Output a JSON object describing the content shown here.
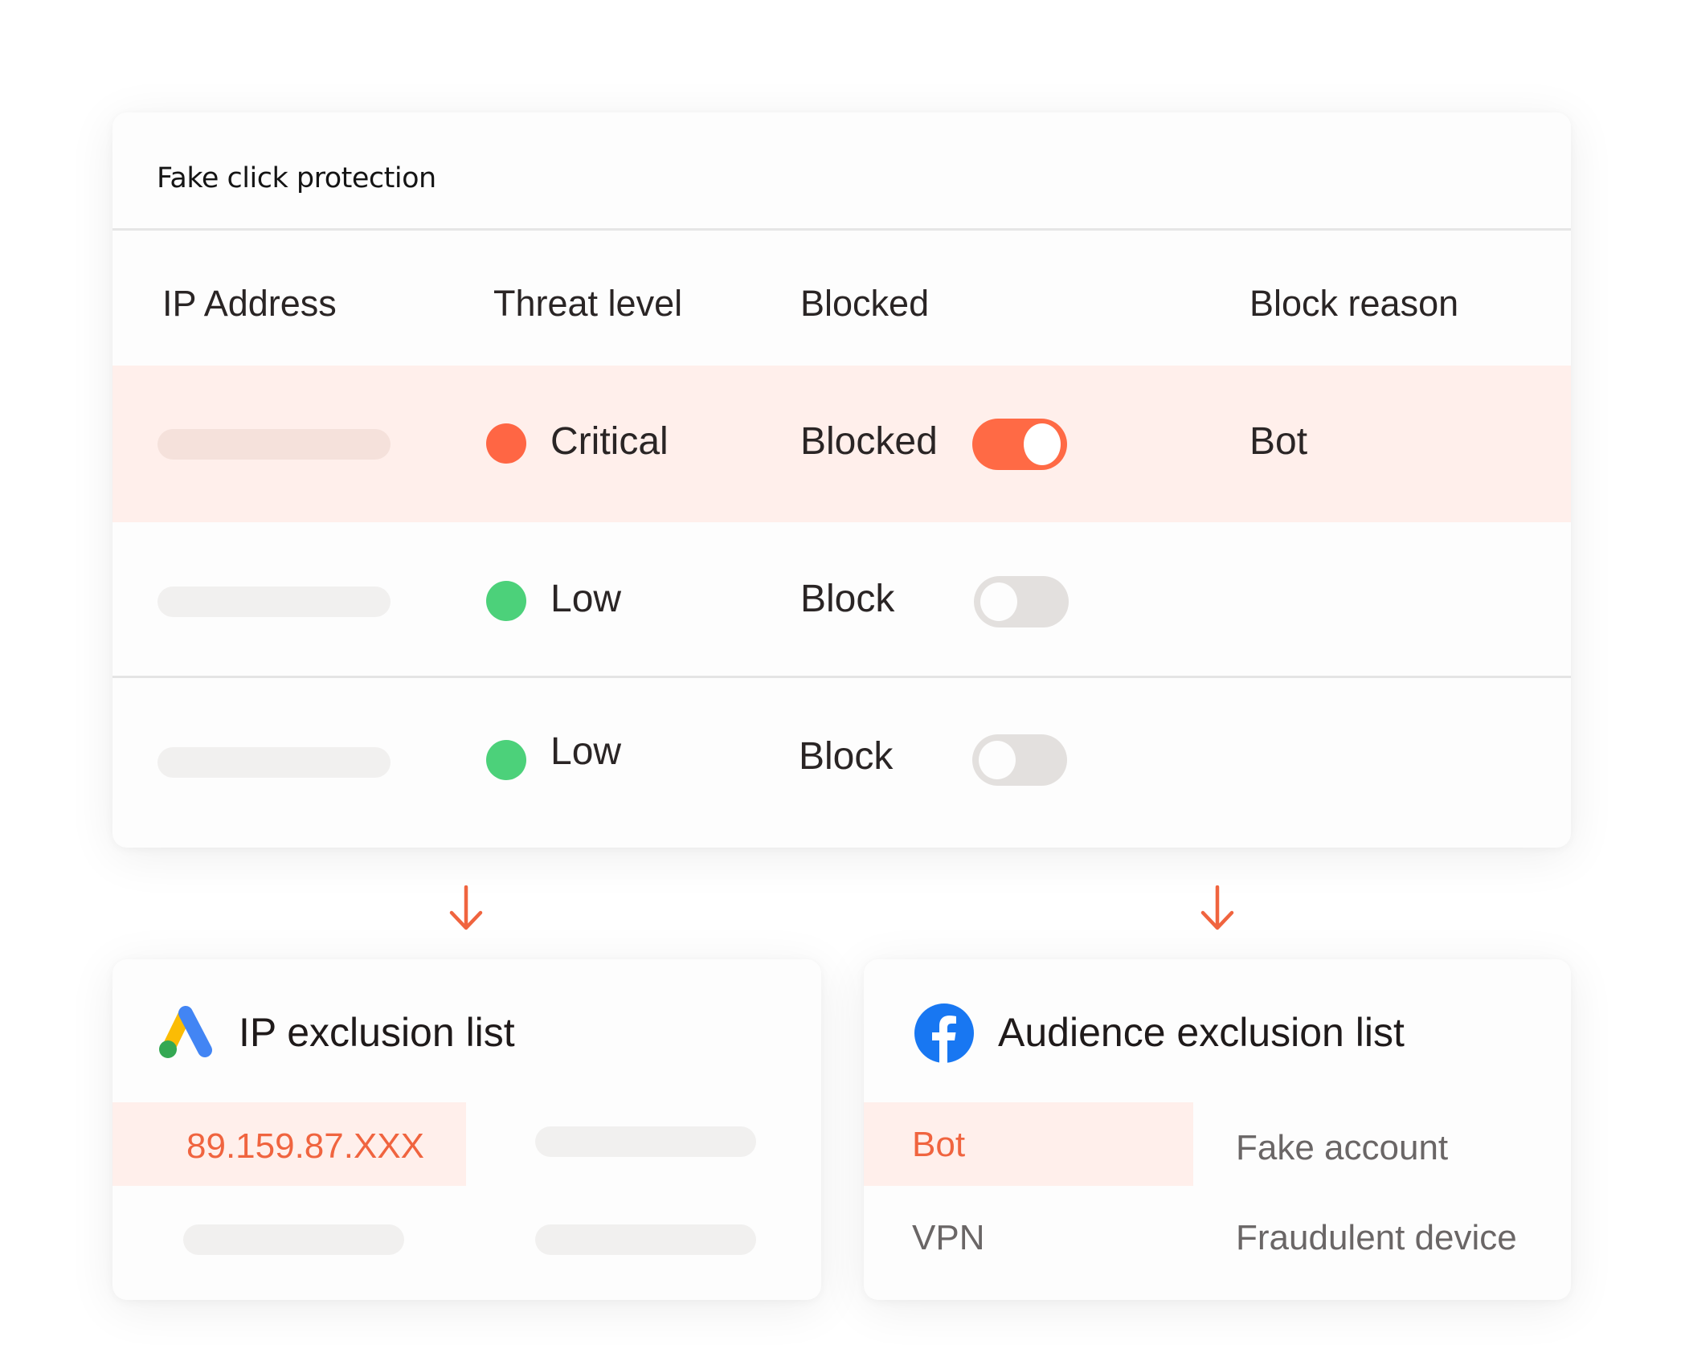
{
  "main_card": {
    "title": "Fake click protection",
    "columns": [
      "IP Address",
      "Threat level",
      "Blocked",
      "Block reason"
    ],
    "rows": [
      {
        "ip": "",
        "threat_level": "Critical",
        "threat_color": "#ff6644",
        "blocked_label": "Blocked",
        "blocked": true,
        "block_reason": "Bot",
        "highlighted": true
      },
      {
        "ip": "",
        "threat_level": "Low",
        "threat_color": "#4cd17a",
        "blocked_label": "Block",
        "blocked": false,
        "block_reason": "",
        "highlighted": false
      },
      {
        "ip": "",
        "threat_level": "Low",
        "threat_color": "#4cd17a",
        "blocked_label": "Block",
        "blocked": false,
        "block_reason": "",
        "highlighted": false
      }
    ]
  },
  "arrows": {
    "color": "#f0643f",
    "icon": "arrow-down-icon"
  },
  "ip_exclusion": {
    "title": "IP exclusion list",
    "icon": "google-ads-logo-icon",
    "entries": [
      "89.159.87.XXX"
    ]
  },
  "audience_exclusion": {
    "title": "Audience exclusion list",
    "icon": "facebook-logo-icon",
    "entries": [
      "Bot",
      "Fake account",
      "VPN",
      "Fraudulent device"
    ]
  },
  "colors": {
    "accent": "#ff6a45",
    "highlight_bg": "#ffefeb",
    "low": "#4cd17a",
    "critical": "#ff6644"
  }
}
